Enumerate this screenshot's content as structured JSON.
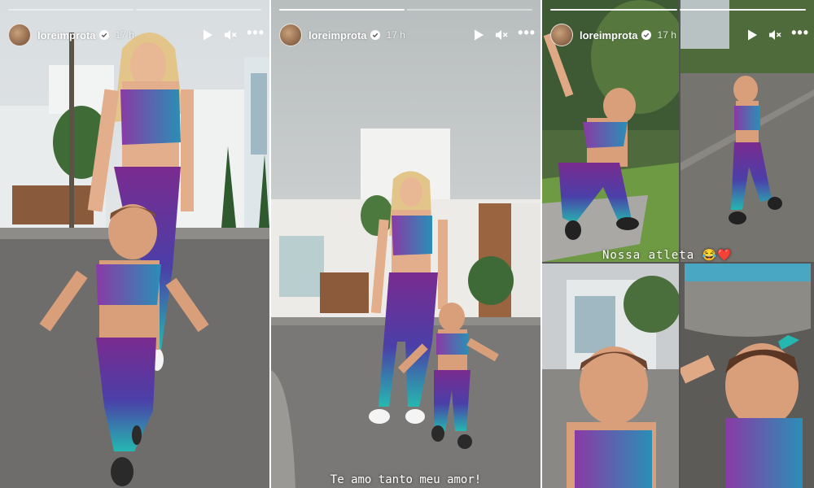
{
  "stories": [
    {
      "username": "loreimprota",
      "time": "17 h",
      "progress": {
        "total": 2,
        "completed": 0
      },
      "caption": ""
    },
    {
      "username": "loreimprota",
      "time": "17 h",
      "progress": {
        "total": 2,
        "completed": 1
      },
      "caption": "Te amo tanto meu amor!"
    },
    {
      "username": "loreimprota",
      "time": "17 h",
      "progress": {
        "total": 2,
        "completed": 2
      },
      "caption": "Nossa atleta 😂❤️"
    }
  ],
  "icons": {
    "play": "play-icon",
    "mute": "mute-icon",
    "more": "more-options-icon",
    "verified": "verified-badge-icon"
  },
  "colors": {
    "leopard_purple": "#7a2b8f",
    "leopard_teal": "#25b8b0",
    "verified_blue": "#ffffff"
  }
}
